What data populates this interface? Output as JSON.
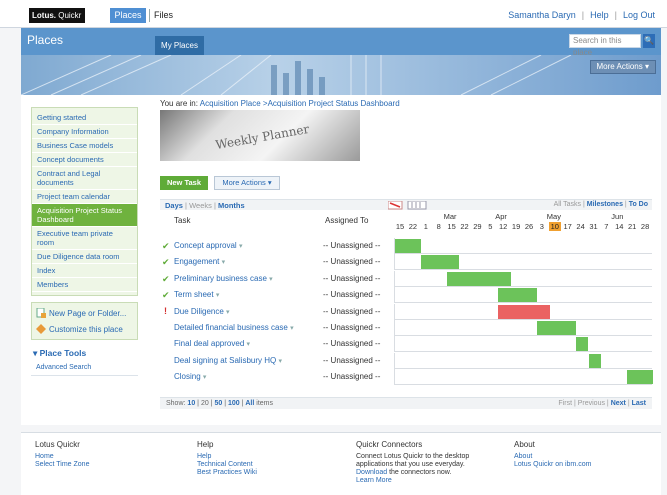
{
  "topbar": {
    "logo_bold": "Lotus.",
    "logo_rest": "Quickr",
    "tabs": [
      "Places",
      "Files"
    ],
    "user": "Samantha Daryn",
    "help": "Help",
    "logout": "Log Out"
  },
  "header": {
    "title": "Places",
    "my_places": "My Places",
    "search_placeholder": "Search in this place",
    "more_actions": "More Actions"
  },
  "nav": {
    "items": [
      "Getting started",
      "Company Information",
      "Business Case models",
      "Concept documents",
      "Contract and Legal documents",
      "Project team calendar",
      "Acquisition Project Status Dashboard",
      "Executive team private room",
      "Due Diligence data room",
      "Index",
      "Members"
    ],
    "active_index": 6,
    "actions": [
      "New Page or Folder...",
      "Customize this place"
    ],
    "place_tools": "Place Tools",
    "advanced_search": "Advanced Search"
  },
  "breadcrumb": {
    "prefix": "You are in: ",
    "place": "Acquisition Place",
    "sep": " >",
    "page": "Acquisition Project Status Dashboard"
  },
  "banner_image_text": "Weekly Planner",
  "toolbar": {
    "new_task": "New Task",
    "more_actions": "More Actions"
  },
  "views": {
    "days": "Days",
    "weeks": "Weeks",
    "months": "Months",
    "all_tasks": "All Tasks",
    "milestones": "Milestones",
    "todo": "To Do"
  },
  "columns": {
    "task": "Task",
    "assigned": "Assigned To"
  },
  "timeline": {
    "months": [
      "Mar",
      "Apr",
      "May",
      "Jun"
    ],
    "days": [
      "15",
      "22",
      "1",
      "8",
      "15",
      "22",
      "29",
      "5",
      "12",
      "19",
      "26",
      "3",
      "10",
      "17",
      "24",
      "31",
      "7",
      "14",
      "21",
      "28"
    ],
    "today_index": 12
  },
  "tasks": [
    {
      "name": "Concept approval",
      "assigned": "-- Unassigned --",
      "status": "done",
      "start": 0,
      "span": 2,
      "color": "#6cc35a"
    },
    {
      "name": "Engagement",
      "assigned": "-- Unassigned --",
      "status": "done",
      "start": 2,
      "span": 3,
      "color": "#6cc35a"
    },
    {
      "name": "Preliminary business case",
      "assigned": "-- Unassigned --",
      "status": "done",
      "start": 4,
      "span": 5,
      "color": "#6cc35a"
    },
    {
      "name": "Term sheet",
      "assigned": "-- Unassigned --",
      "status": "done",
      "start": 8,
      "span": 3,
      "color": "#6cc35a"
    },
    {
      "name": "Due Diligence",
      "assigned": "-- Unassigned --",
      "status": "warning",
      "start": 8,
      "span": 4,
      "color": "#ea6262"
    },
    {
      "name": "Detailed financial business case",
      "assigned": "-- Unassigned --",
      "status": "none",
      "start": 11,
      "span": 3,
      "color": "#6cc35a"
    },
    {
      "name": "Final deal approved",
      "assigned": "-- Unassigned --",
      "status": "none",
      "start": 14,
      "span": 1,
      "color": "#6cc35a"
    },
    {
      "name": "Deal signing at Salisbury HQ",
      "assigned": "-- Unassigned --",
      "status": "none",
      "start": 15,
      "span": 1,
      "color": "#6cc35a"
    },
    {
      "name": "Closing",
      "assigned": "-- Unassigned --",
      "status": "none",
      "start": 18,
      "span": 2,
      "color": "#6cc35a"
    }
  ],
  "grid_footer": {
    "show": "Show:",
    "sizes": [
      "10",
      "20",
      "50",
      "100",
      "All"
    ],
    "items": "items",
    "first": "First",
    "previous": "Previous",
    "next": "Next",
    "last": "Last"
  },
  "footer": {
    "col1": {
      "title": "Lotus Quickr",
      "links": [
        "Home",
        "Select Time Zone"
      ]
    },
    "col2": {
      "title": "Help",
      "links": [
        "Help",
        "Technical Content",
        "Best Practices Wiki"
      ]
    },
    "col3": {
      "title": "Quickr Connectors",
      "text1": "Connect Lotus Quickr to the desktop",
      "text2": "applications that you use everyday.",
      "download": "Download",
      "text3": " the connectors now.",
      "learn": "Learn More"
    },
    "col4": {
      "title": "About",
      "links": [
        "About",
        "Lotus Quickr on ibm.com"
      ]
    }
  }
}
